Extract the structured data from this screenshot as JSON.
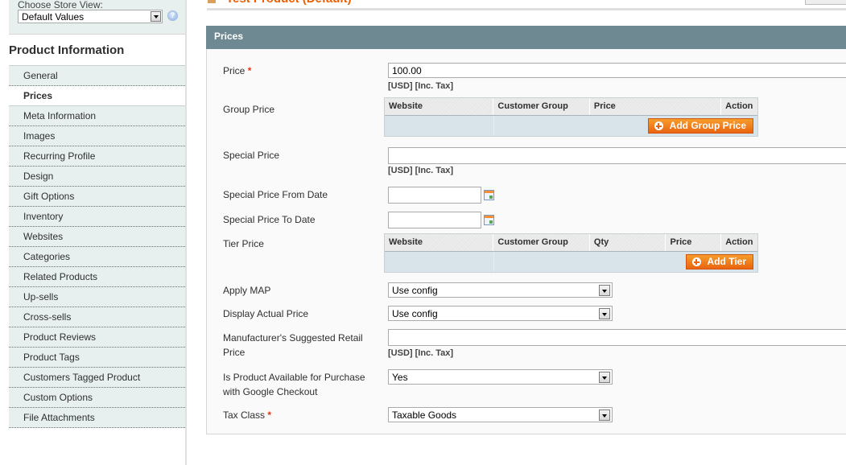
{
  "header": {
    "title": "Test Product (Default)"
  },
  "store_switcher": {
    "label": "Choose Store View:",
    "value": "Default Values"
  },
  "sidebar": {
    "title": "Product Information",
    "tabs": [
      {
        "label": "General",
        "active": false
      },
      {
        "label": "Prices",
        "active": true
      },
      {
        "label": "Meta Information",
        "active": false
      },
      {
        "label": "Images",
        "active": false
      },
      {
        "label": "Recurring Profile",
        "active": false
      },
      {
        "label": "Design",
        "active": false
      },
      {
        "label": "Gift Options",
        "active": false
      },
      {
        "label": "Inventory",
        "active": false
      },
      {
        "label": "Websites",
        "active": false
      },
      {
        "label": "Categories",
        "active": false
      },
      {
        "label": "Related Products",
        "active": false
      },
      {
        "label": "Up-sells",
        "active": false
      },
      {
        "label": "Cross-sells",
        "active": false
      },
      {
        "label": "Product Reviews",
        "active": false
      },
      {
        "label": "Product Tags",
        "active": false
      },
      {
        "label": "Customers Tagged Product",
        "active": false
      },
      {
        "label": "Custom Options",
        "active": false
      },
      {
        "label": "File Attachments",
        "active": false
      }
    ]
  },
  "section": {
    "title": "Prices",
    "required_mark": "*",
    "currency_note": "[USD] [Inc. Tax]",
    "price": {
      "label": "Price",
      "value": "100.00"
    },
    "group_price": {
      "label": "Group Price",
      "columns": [
        "Website",
        "Customer Group",
        "Price",
        "Action"
      ],
      "button": "Add Group Price"
    },
    "special_price": {
      "label": "Special Price",
      "value": ""
    },
    "special_from": {
      "label": "Special Price From Date",
      "value": ""
    },
    "special_to": {
      "label": "Special Price To Date",
      "value": ""
    },
    "tier_price": {
      "label": "Tier Price",
      "columns": [
        "Website",
        "Customer Group",
        "Qty",
        "Price",
        "Action"
      ],
      "button": "Add Tier"
    },
    "apply_map": {
      "label": "Apply MAP",
      "value": "Use config"
    },
    "display_actual_price": {
      "label": "Display Actual Price",
      "value": "Use config"
    },
    "msrp": {
      "label_line1": "Manufacturer's Suggested Retail",
      "label_line2": "Price",
      "value": ""
    },
    "google_checkout": {
      "label_line1": "Is Product Available for Purchase",
      "label_line2": "with Google Checkout",
      "value": "Yes"
    },
    "tax_class": {
      "label": "Tax Class",
      "value": "Taxable Goods"
    }
  }
}
